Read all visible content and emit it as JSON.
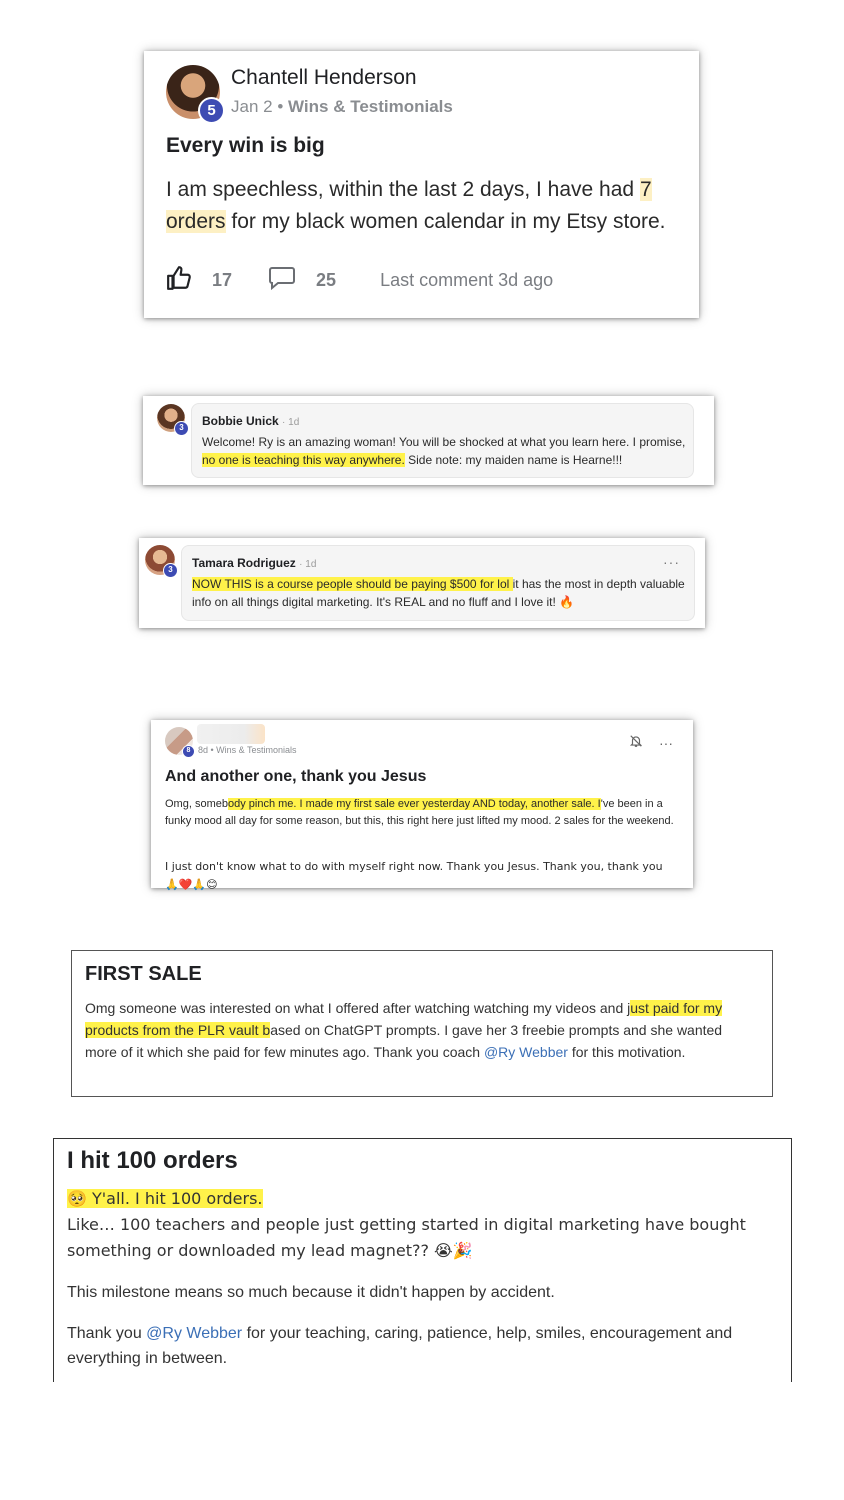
{
  "post1": {
    "author": "Chantell Henderson",
    "level": "5",
    "date": "Jan 2",
    "separator": "•",
    "category": "Wins & Testimonials",
    "title": "Every win is big",
    "body_before": "I am speechless, within the last 2 days, I have had ",
    "body_highlight": "7 orders",
    "body_after": " for my black women calendar in my Etsy store.",
    "likes": "17",
    "comments": "25",
    "last_comment": "Last comment 3d ago"
  },
  "comment1": {
    "author": "Bobbie Unick",
    "time": "· 1d",
    "level": "3",
    "text_before": "Welcome! Ry is an amazing woman! You will be shocked at what you learn here. I promise, ",
    "text_highlight": "no one is teaching this way anywhere.",
    "text_after": " Side note: my maiden name is Hearne!!!"
  },
  "comment2": {
    "author": "Tamara Rodriguez",
    "time": "· 1d",
    "level": "3",
    "more": "···",
    "text_highlight": "NOW THIS is a course people should be paying $500 for lol ",
    "text_after": "it has the most in depth valuable info on all things digital marketing. It's REAL and no fluff and I love it! 🔥"
  },
  "post2": {
    "level": "8",
    "meta": "8d • Wins & Testimonials",
    "title": "And another one, thank you Jesus",
    "p1_before": "Omg, someb",
    "p1_highlight": "ody pinch me. I made my first sale ever yesterday AND today, another sale. I",
    "p1_after": "'ve been in a funky mood all day for some reason, but this, this right here just lifted my mood. 2 sales for the weekend.",
    "p2": "I just don't know what to do with myself right now. Thank you Jesus. Thank you, thank you 🙏❤️🙏😊",
    "bell_icon": "bell-off-icon",
    "more": "···"
  },
  "post3": {
    "title": "FIRST SALE",
    "body_before": "Omg someone was interested on what I offered after watching watching my videos and j",
    "body_highlight": "ust paid for my products from the PLR vault b",
    "body_after": "ased on ChatGPT prompts. I gave her 3 freebie prompts and she wanted more of it which she paid for few minutes ago. Thank you coach ",
    "mention": "@Ry Webber",
    "body_end": " for this motivation."
  },
  "post4": {
    "title": "I hit 100 orders",
    "line1": "🥺 Y'all. I hit 100 orders.",
    "line2": "Like… 100 teachers and people just getting started in digital marketing have bought something or downloaded my lead magnet?? 😭🎉",
    "para2": "This milestone means so much because it didn't happen by accident.",
    "para3_before": "Thank you ",
    "mention": "@Ry Webber",
    "para3_after": " for your teaching, caring, patience, help, smiles, encouragement and everything in between."
  },
  "colors": {
    "highlight": "#fff24a",
    "badge": "#3d4bb3",
    "mention": "#3b6fb6"
  }
}
